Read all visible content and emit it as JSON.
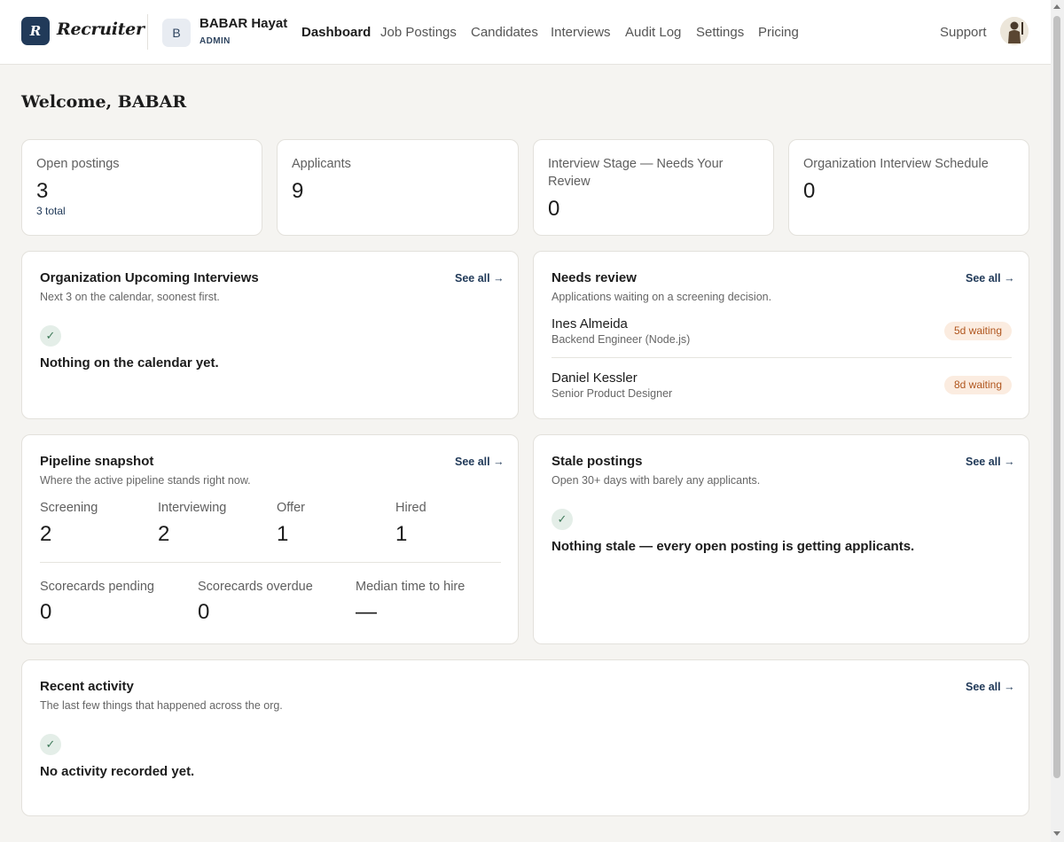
{
  "header": {
    "logo_letter": "R",
    "logo_text": "Recruiter",
    "org_initial": "B",
    "org_name": "BABAR Hayat",
    "org_role": "ADMIN",
    "nav": [
      "Dashboard",
      "Job Postings",
      "Candidates",
      "Interviews",
      "Audit Log",
      "Settings",
      "Pricing"
    ],
    "active_nav": "Dashboard",
    "support_label": "Support"
  },
  "welcome": "Welcome, BABAR",
  "stats": [
    {
      "label": "Open postings",
      "value": "3",
      "sub": "3 total"
    },
    {
      "label": "Applicants",
      "value": "9"
    },
    {
      "label": "Interview Stage — Needs Your Review",
      "value": "0"
    },
    {
      "label": "Organization Interview Schedule",
      "value": "0"
    }
  ],
  "upcoming": {
    "title": "Organization Upcoming Interviews",
    "desc": "Next 3 on the calendar, soonest first.",
    "see_all": "See all →",
    "check": "✓",
    "empty": "Nothing on the calendar yet."
  },
  "needs_review": {
    "title": "Needs review",
    "desc": "Applications waiting on a screening decision.",
    "see_all": "See all →",
    "items": [
      {
        "name": "Ines Almeida",
        "role": "Backend Engineer (Node.js)",
        "badge": "5d waiting"
      },
      {
        "name": "Daniel Kessler",
        "role": "Senior Product Designer",
        "badge": "8d waiting"
      }
    ]
  },
  "pipeline": {
    "title": "Pipeline snapshot",
    "desc": "Where the active pipeline stands right now.",
    "see_all": "See all →",
    "stages": [
      {
        "label": "Screening",
        "value": "2"
      },
      {
        "label": "Interviewing",
        "value": "2"
      },
      {
        "label": "Offer",
        "value": "1"
      },
      {
        "label": "Hired",
        "value": "1"
      }
    ],
    "metrics": [
      {
        "label": "Scorecards pending",
        "value": "0"
      },
      {
        "label": "Scorecards overdue",
        "value": "0"
      },
      {
        "label": "Median time to hire",
        "value": "—"
      }
    ]
  },
  "stale": {
    "title": "Stale postings",
    "desc": "Open 30+ days with barely any applicants.",
    "see_all": "See all →",
    "check": "✓",
    "empty": "Nothing stale — every open posting is getting applicants."
  },
  "activity": {
    "title": "Recent activity",
    "desc": "The last few things that happened across the org.",
    "see_all": "See all →",
    "check": "✓",
    "empty": "No activity recorded yet."
  },
  "colors": {
    "brand": "#213a59",
    "background": "#f5f4f1",
    "badge_bg": "#fbece0",
    "badge_text": "#b0561e",
    "check_bg": "#e4eee8"
  },
  "icons": {
    "check": "check-icon",
    "user_avatar": "user-avatar-photo"
  }
}
